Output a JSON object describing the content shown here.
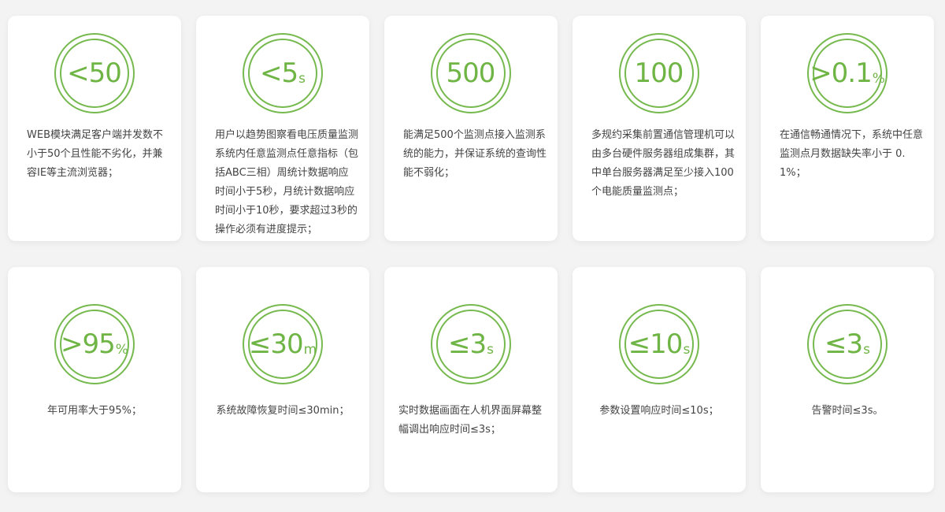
{
  "accent_color": "#76b94e",
  "cards": [
    {
      "metric": "<50",
      "unit": "",
      "desc": "WEB模块满足客户端并发数不小于50个且性能不劣化，并兼容IE等主流浏览器；"
    },
    {
      "metric": "<5",
      "unit": "s",
      "desc": "用户以趋势图察看电压质量监测系统内任意监测点任意指标（包括ABC三相）周统计数据响应时间小于5秒，月统计数据响应时间小于10秒，要求超过3秒的操作必须有进度提示；"
    },
    {
      "metric": "500",
      "unit": "",
      "desc": "能满足500个监测点接入监测系统的能力，并保证系统的查询性能不弱化；"
    },
    {
      "metric": "100",
      "unit": "",
      "desc": "多规约采集前置通信管理机可以由多台硬件服务器组成集群，其中单台服务器满足至少接入100个电能质量监测点；"
    },
    {
      "metric": ">0.1",
      "unit": "%",
      "desc": "在通信畅通情况下，系统中任意监测点月数据缺失率小于 0.1%；"
    },
    {
      "metric": ">95",
      "unit": "%",
      "desc": "年可用率大于95%；"
    },
    {
      "metric": "≤30",
      "unit": "m",
      "desc": "系统故障恢复时间≤30min；"
    },
    {
      "metric": "≤3",
      "unit": "s",
      "desc": "实时数据画面在人机界面屏幕整幅调出响应时间≤3s；"
    },
    {
      "metric": "≤10",
      "unit": "s",
      "desc": "参数设置响应时间≤10s；"
    },
    {
      "metric": "≤3",
      "unit": "s",
      "desc": "告警时间≤3s。"
    }
  ]
}
